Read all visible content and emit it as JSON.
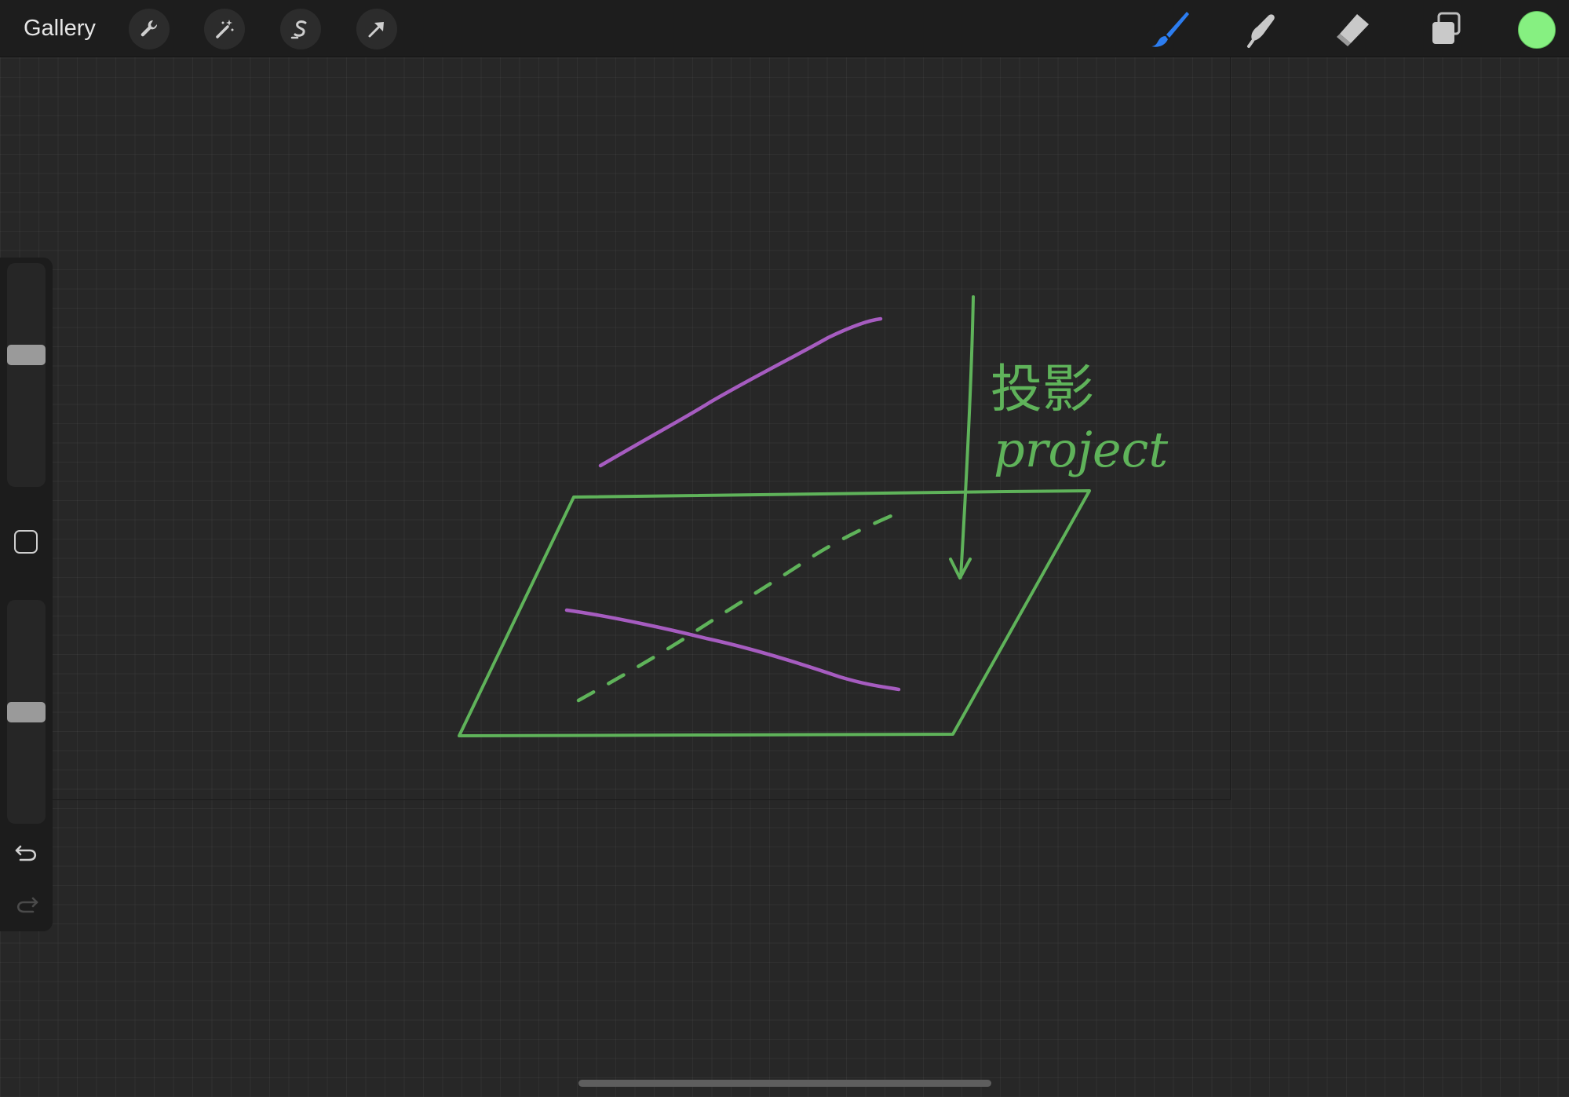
{
  "toolbar": {
    "gallery_label": "Gallery",
    "left_tools": [
      "wrench-icon",
      "magic-wand-icon",
      "selection-s-icon",
      "arrow-cursor-icon"
    ],
    "right_tools": [
      "brush-icon",
      "smudge-icon",
      "eraser-icon",
      "layers-icon"
    ],
    "active_tool": "brush",
    "current_color": "#86f081"
  },
  "sidebar": {
    "brush_size_level": 0.6,
    "opacity_level": 0.5,
    "icons": [
      "square-modify-icon",
      "undo-icon",
      "redo-icon"
    ]
  },
  "canvas": {
    "annotation_chinese": "投影",
    "annotation_english": "project",
    "stroke_colors": {
      "green": "#5fb35a",
      "purple": "#a65cc0"
    }
  },
  "colors": {
    "toolbar_bg": "#1d1d1d",
    "canvas_bg": "#272727",
    "brush_active": "#2c7df0"
  }
}
